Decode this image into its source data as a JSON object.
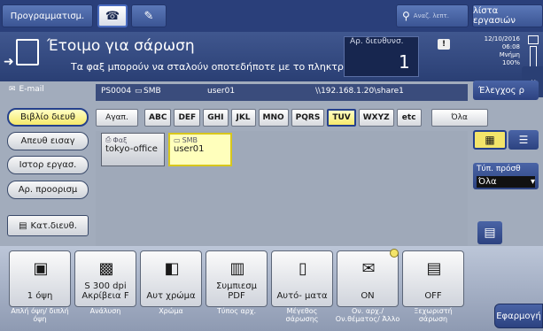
{
  "topbar": {
    "program_label": "Προγραμματισμ.",
    "search_label": "Αναζ. λεπτ.",
    "job_list_label": "λίστα εργασιών"
  },
  "status": {
    "title": "Έτοιμο για σάρωση",
    "message": "Τα φαξ μπορούν να σταλούν οποτεδήποτε με το πληκτρολόγιο",
    "dest_count_label": "Αρ. διευθυνσ.",
    "dest_count": "1",
    "date": "12/10/2016",
    "time": "06:08",
    "memory_label": "Μνήμη",
    "memory_value": "100%"
  },
  "mode_tab": {
    "label": "E-mail"
  },
  "control_button": {
    "label": "Έλεγχος ρ"
  },
  "dest_info": {
    "id_type": "PS0004",
    "type": "SMB",
    "user": "user01",
    "path": "\\\\192.168.1.20\\share1"
  },
  "nav": {
    "address_book": "Βιβλίο διευθ",
    "direct_input": "Απευθ εισαγ",
    "job_history": "Ιστορ εργασ.",
    "dest_number": "Αρ. προορισμ",
    "category": "Κατ.διευθ."
  },
  "index_tabs": [
    "Αγαπ.",
    "ABC",
    "DEF",
    "GHI",
    "JKL",
    "MNO",
    "PQRS",
    "TUV",
    "WXYZ",
    "etc",
    "Όλα"
  ],
  "index_selected": "TUV",
  "destinations": [
    {
      "type": "Φαξ",
      "name": "tokyo-office",
      "selected": false
    },
    {
      "type": "SMB",
      "name": "user01",
      "selected": true
    }
  ],
  "file_type": {
    "label": "Τύπ. πρόσθ",
    "value": "Όλα"
  },
  "functions": [
    {
      "value": "1 όψη",
      "label": "Απλή όψη/ διπλή όψη",
      "icon": "duplex-icon"
    },
    {
      "value": "S 300 dpi Ακρίβεια F",
      "label": "Ανάλυση",
      "icon": "resolution-icon"
    },
    {
      "value": "Αυτ χρώμα",
      "label": "Χρώμα",
      "icon": "color-icon"
    },
    {
      "value": "Συμπιεσμ PDF",
      "label": "Τύπος αρχ.",
      "icon": "pdf-icon"
    },
    {
      "value": "Αυτό- ματα",
      "label": "Μέγεθος σάρωσης",
      "icon": "scan-size-icon"
    },
    {
      "value": "ON",
      "label": "Ον. αρχ./ Ον.θέματος/ Άλλο",
      "icon": "filename-icon"
    },
    {
      "value": "OFF",
      "label": "Ξεχωριστή σάρωση",
      "icon": "separate-scan-icon"
    }
  ],
  "apply_button": {
    "label": "Εφαρμογή"
  }
}
